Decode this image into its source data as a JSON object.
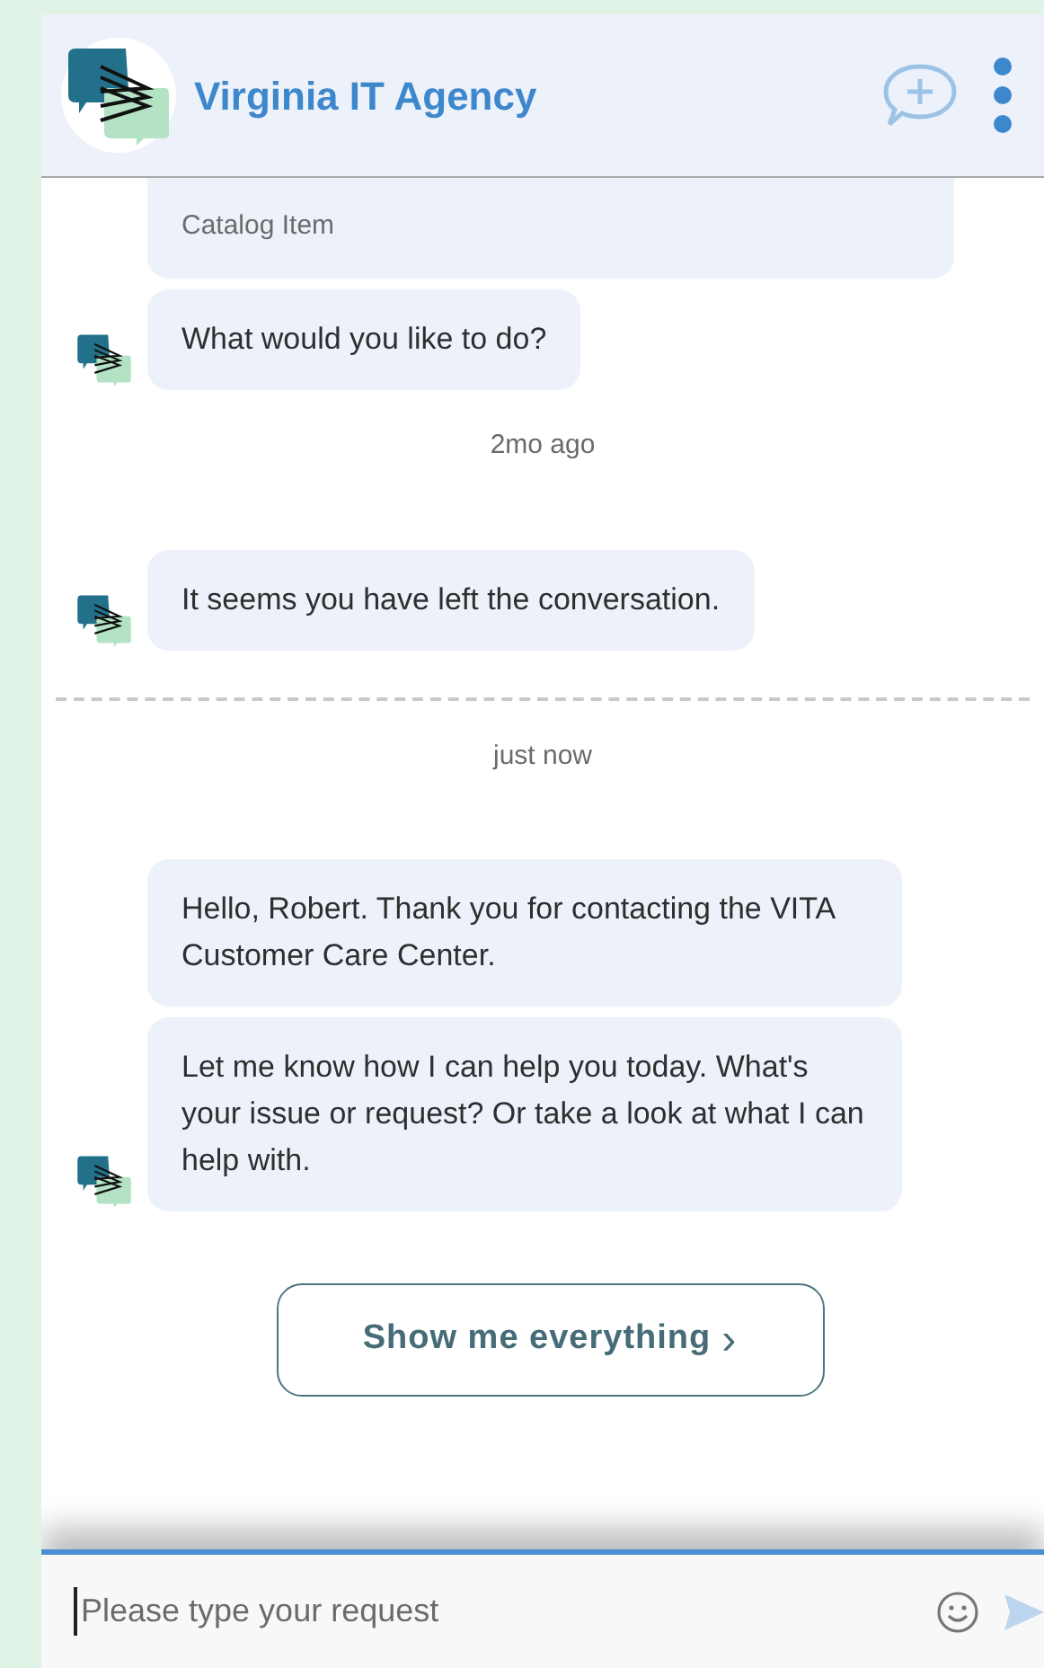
{
  "header": {
    "title": "Virginia IT Agency"
  },
  "messages": [
    {
      "kind": "note",
      "text": "Catalog Item",
      "avatar": false
    },
    {
      "kind": "bubble",
      "text": "What would you like to do?",
      "avatar": true
    },
    {
      "kind": "time",
      "text": "2mo ago"
    },
    {
      "kind": "bubble",
      "text": "It seems you have left the conversation.",
      "avatar": true
    },
    {
      "kind": "divider"
    },
    {
      "kind": "time",
      "text": "just now"
    },
    {
      "kind": "bubble",
      "text": "Hello, Robert. Thank you for contacting the VITA Customer Care Center.",
      "avatar": false
    },
    {
      "kind": "bubble",
      "text": "Let me know how I can help you today. What's your issue or request? Or take a look at what I can help with.",
      "avatar": true
    },
    {
      "kind": "button",
      "text": "Show me everything",
      "chevron": "›"
    }
  ],
  "composer": {
    "placeholder": "Please type your request"
  }
}
